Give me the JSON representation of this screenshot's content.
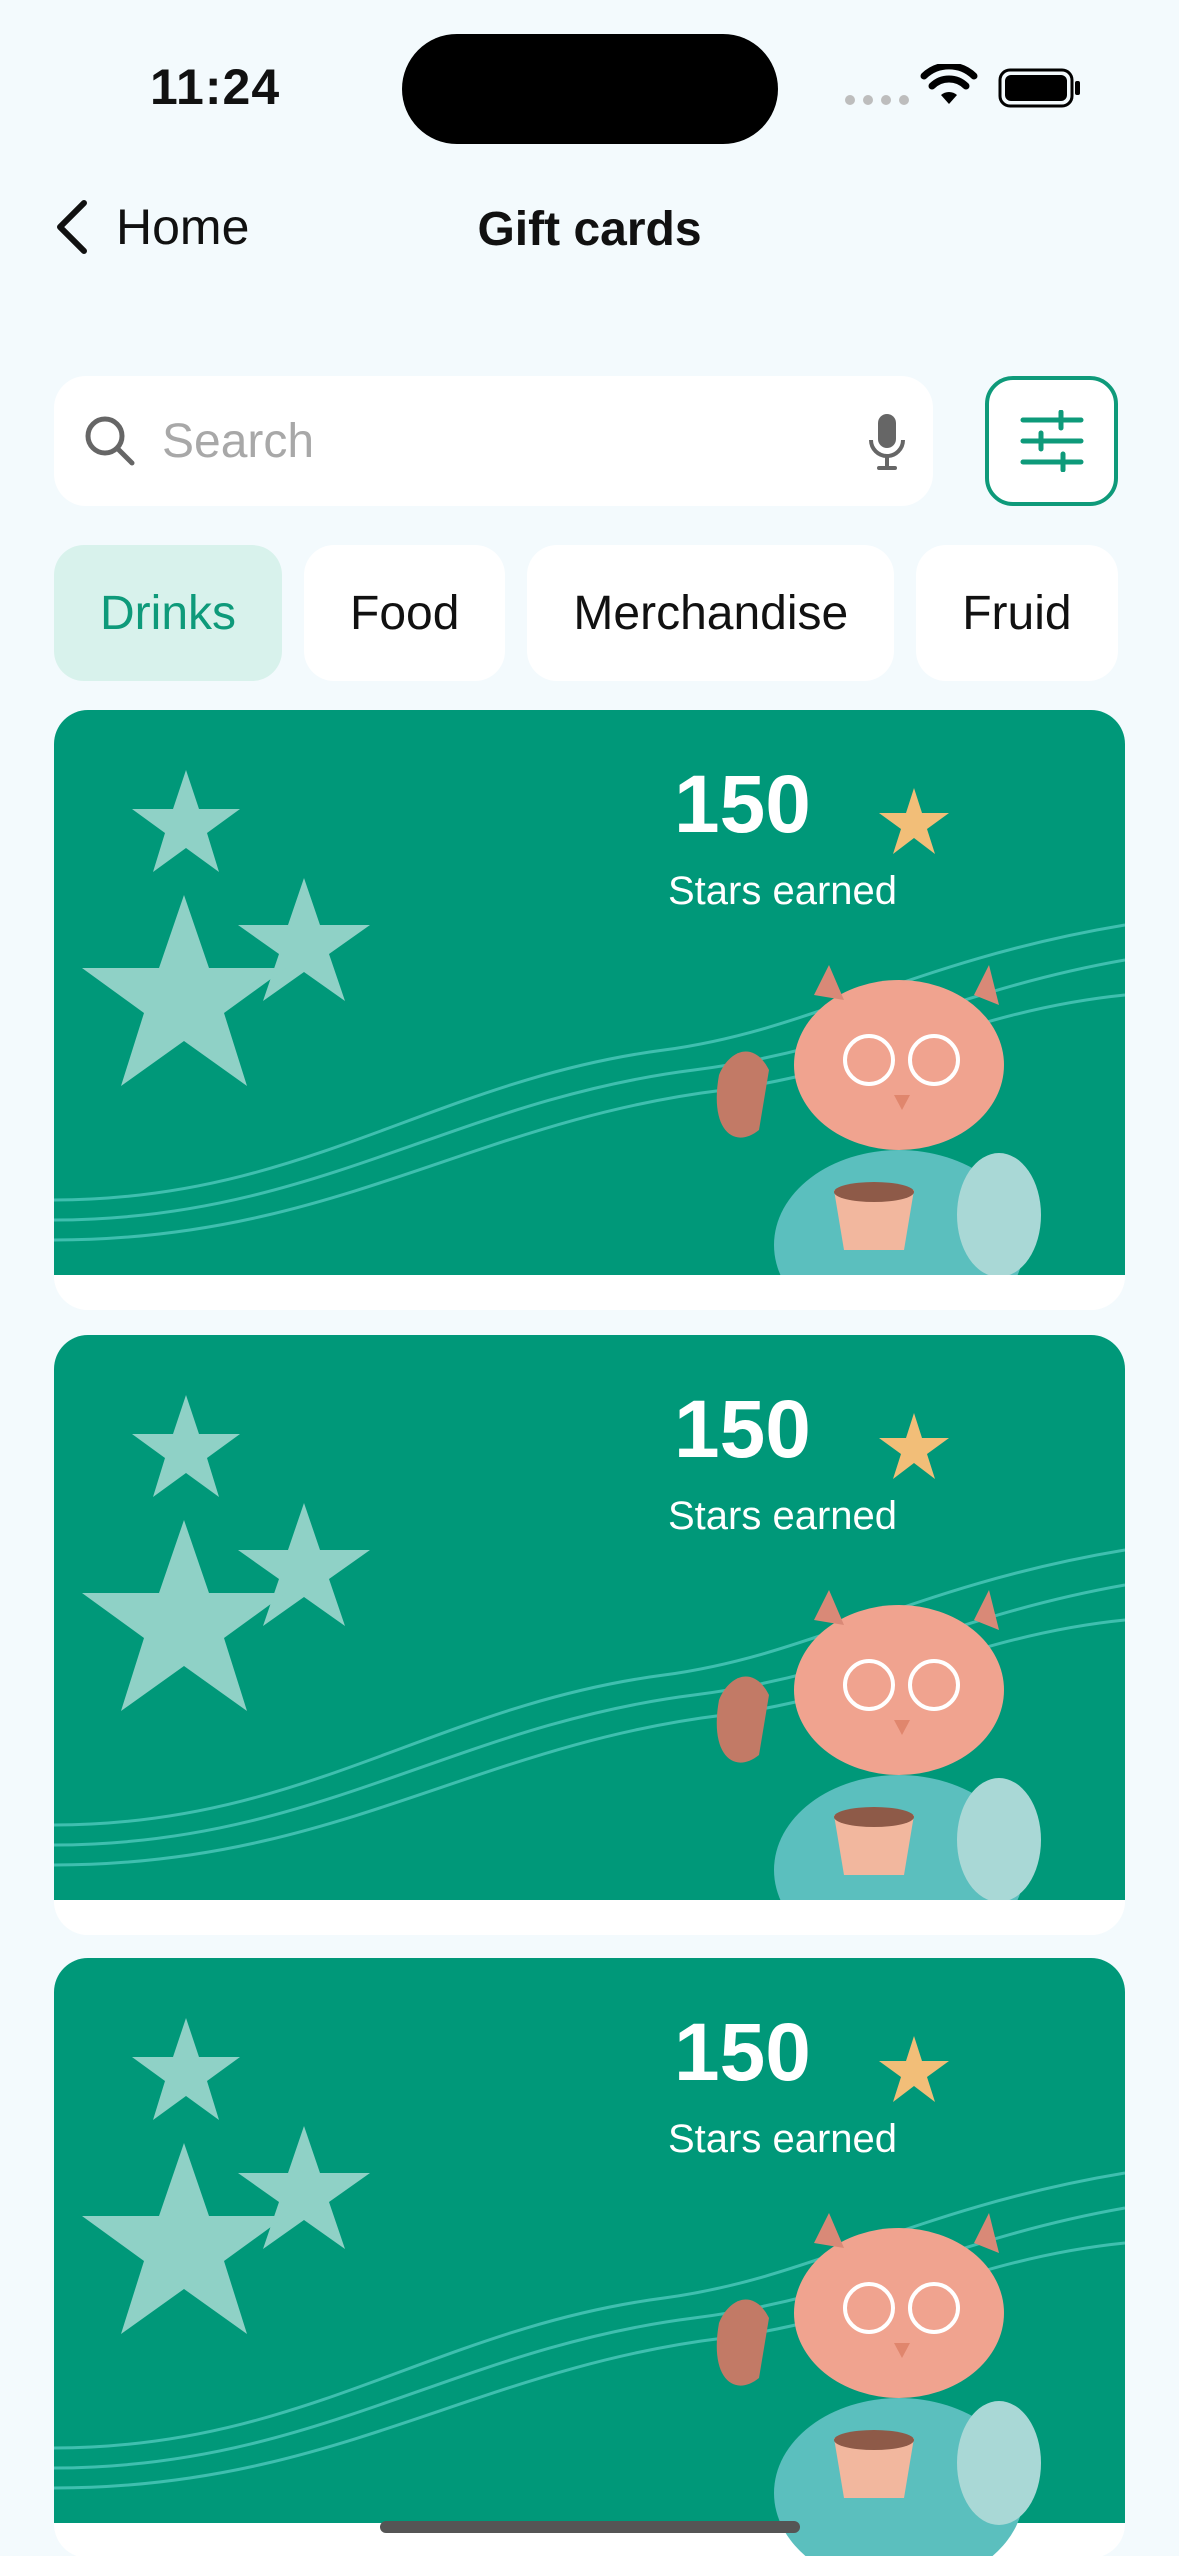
{
  "status": {
    "time": "11:24"
  },
  "nav": {
    "back_label": "Home",
    "title": "Gift cards"
  },
  "search": {
    "placeholder": "Search",
    "value": ""
  },
  "chips": [
    "Drinks",
    "Food",
    "Merchandise",
    "Fruid"
  ],
  "active_chip": "Drinks",
  "cards": [
    {
      "stars": "150",
      "caption": "Stars earned"
    },
    {
      "stars": "150",
      "caption": "Stars earned"
    },
    {
      "stars": "150",
      "caption": "Stars earned"
    }
  ],
  "colors": {
    "accent": "#0E9A7A",
    "card_bg": "#009879",
    "star": "#F2BE78",
    "background": "#F3FAFD"
  },
  "icons": [
    "chevron-left-icon",
    "search-icon",
    "microphone-icon",
    "sliders-icon",
    "wifi-icon",
    "battery-icon"
  ]
}
